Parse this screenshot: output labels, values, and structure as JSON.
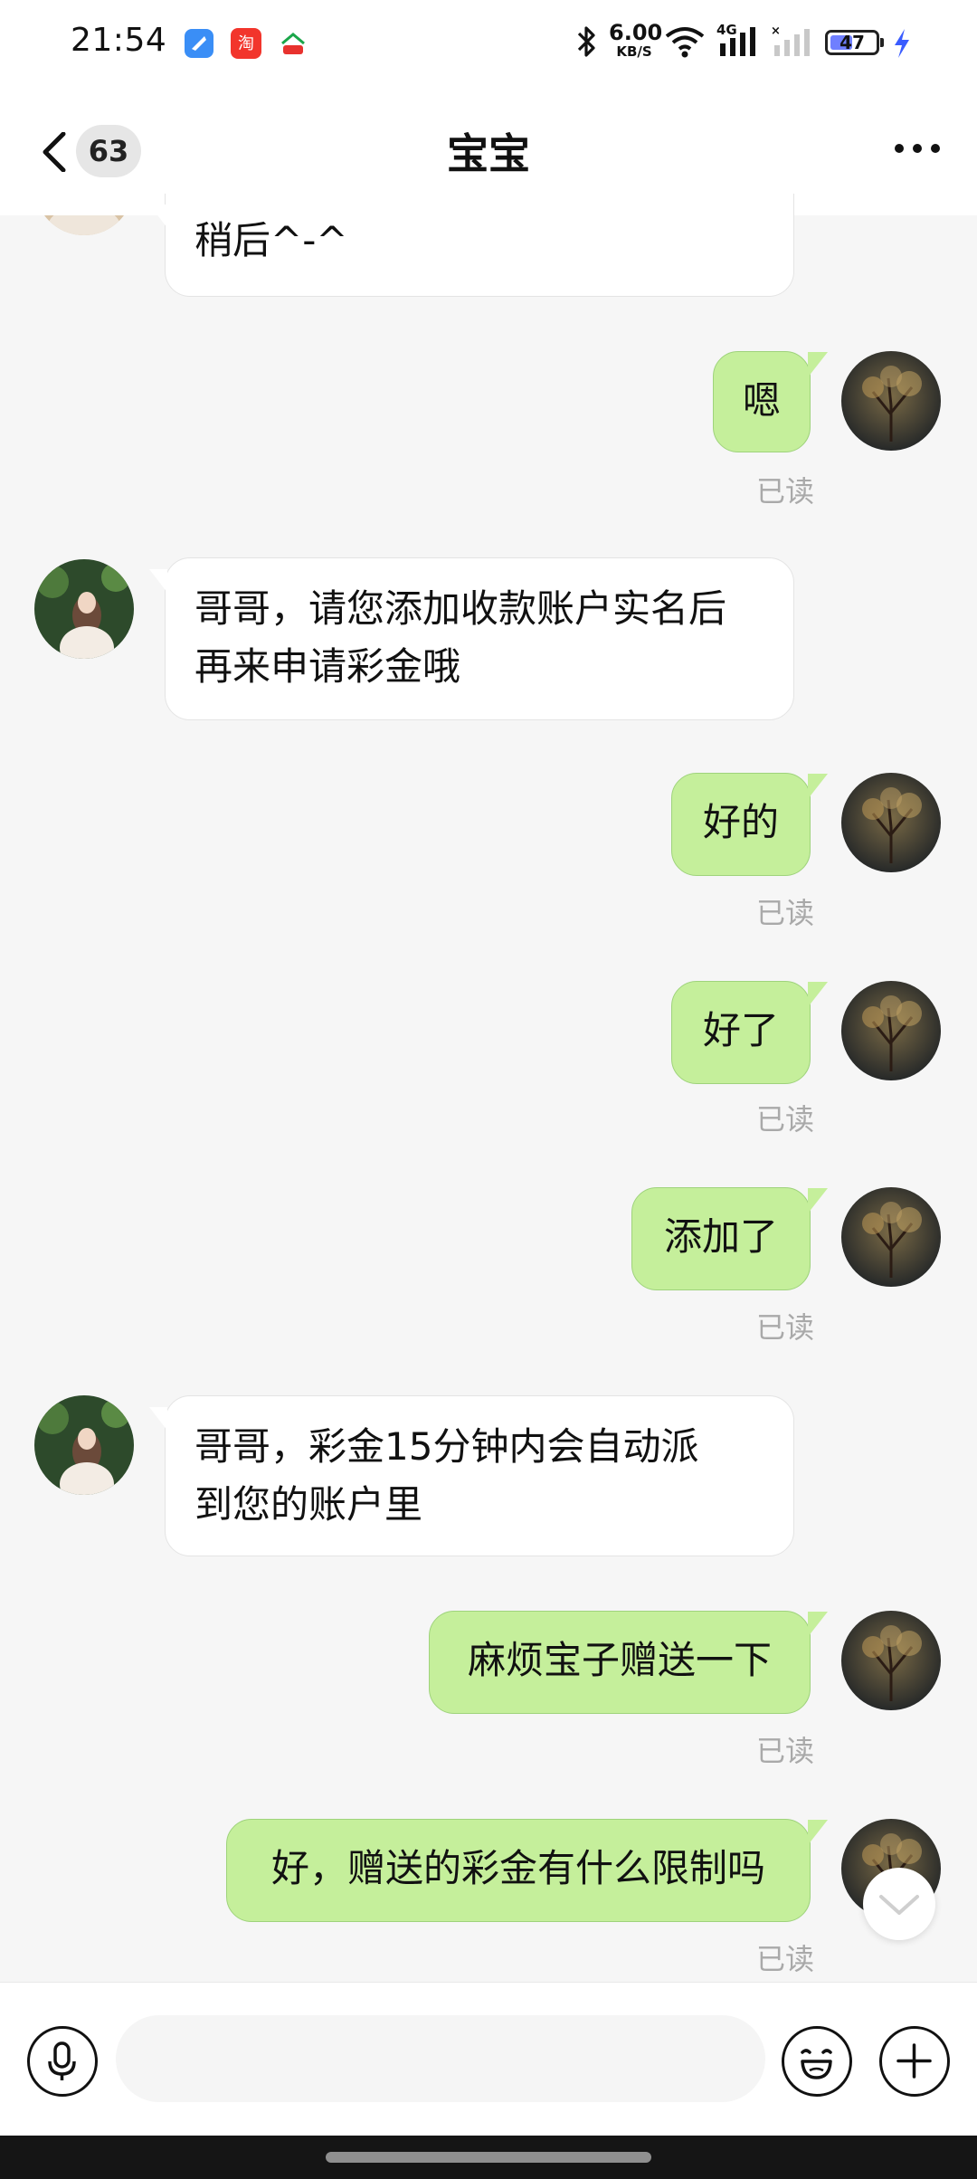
{
  "status_bar": {
    "time": "21:54",
    "net_speed_value": "6.00",
    "net_speed_unit": "KB/S",
    "network_label": "4G",
    "battery": "47",
    "icons": [
      "blue-app-icon",
      "taobao-icon",
      "mall-app-icon",
      "bluetooth-icon",
      "wifi-icon",
      "signal-icon",
      "signal-2-icon",
      "charging-icon"
    ]
  },
  "header": {
    "unread_count": "63",
    "title": "宝宝",
    "icons": [
      "back-chevron-icon",
      "more-icon"
    ]
  },
  "messages": [
    {
      "side": "in",
      "text": "稍后^-^"
    },
    {
      "side": "out",
      "text": "嗯",
      "read": "已读"
    },
    {
      "side": "in",
      "lines": [
        "哥哥，请您添加收款账户实名后",
        "再来申请彩金哦"
      ]
    },
    {
      "side": "out",
      "text": "好的",
      "read": "已读"
    },
    {
      "side": "out",
      "text": "好了",
      "read": "已读"
    },
    {
      "side": "out",
      "text": "添加了",
      "read": "已读"
    },
    {
      "side": "in",
      "lines": [
        "哥哥，彩金15分钟内会自动派",
        "到您的账户里"
      ]
    },
    {
      "side": "out",
      "text": "麻烦宝子赠送一下",
      "read": "已读"
    },
    {
      "side": "out",
      "text": "好，赠送的彩金有什么限制吗",
      "read": "已读"
    }
  ],
  "input_bar": {
    "placeholder": "",
    "icons": [
      "microphone-icon",
      "emoji-icon",
      "plus-icon"
    ]
  },
  "colors": {
    "outgoing_bubble": "#c5ef9b",
    "incoming_bubble": "#ffffff",
    "background": "#f6f6f6"
  }
}
